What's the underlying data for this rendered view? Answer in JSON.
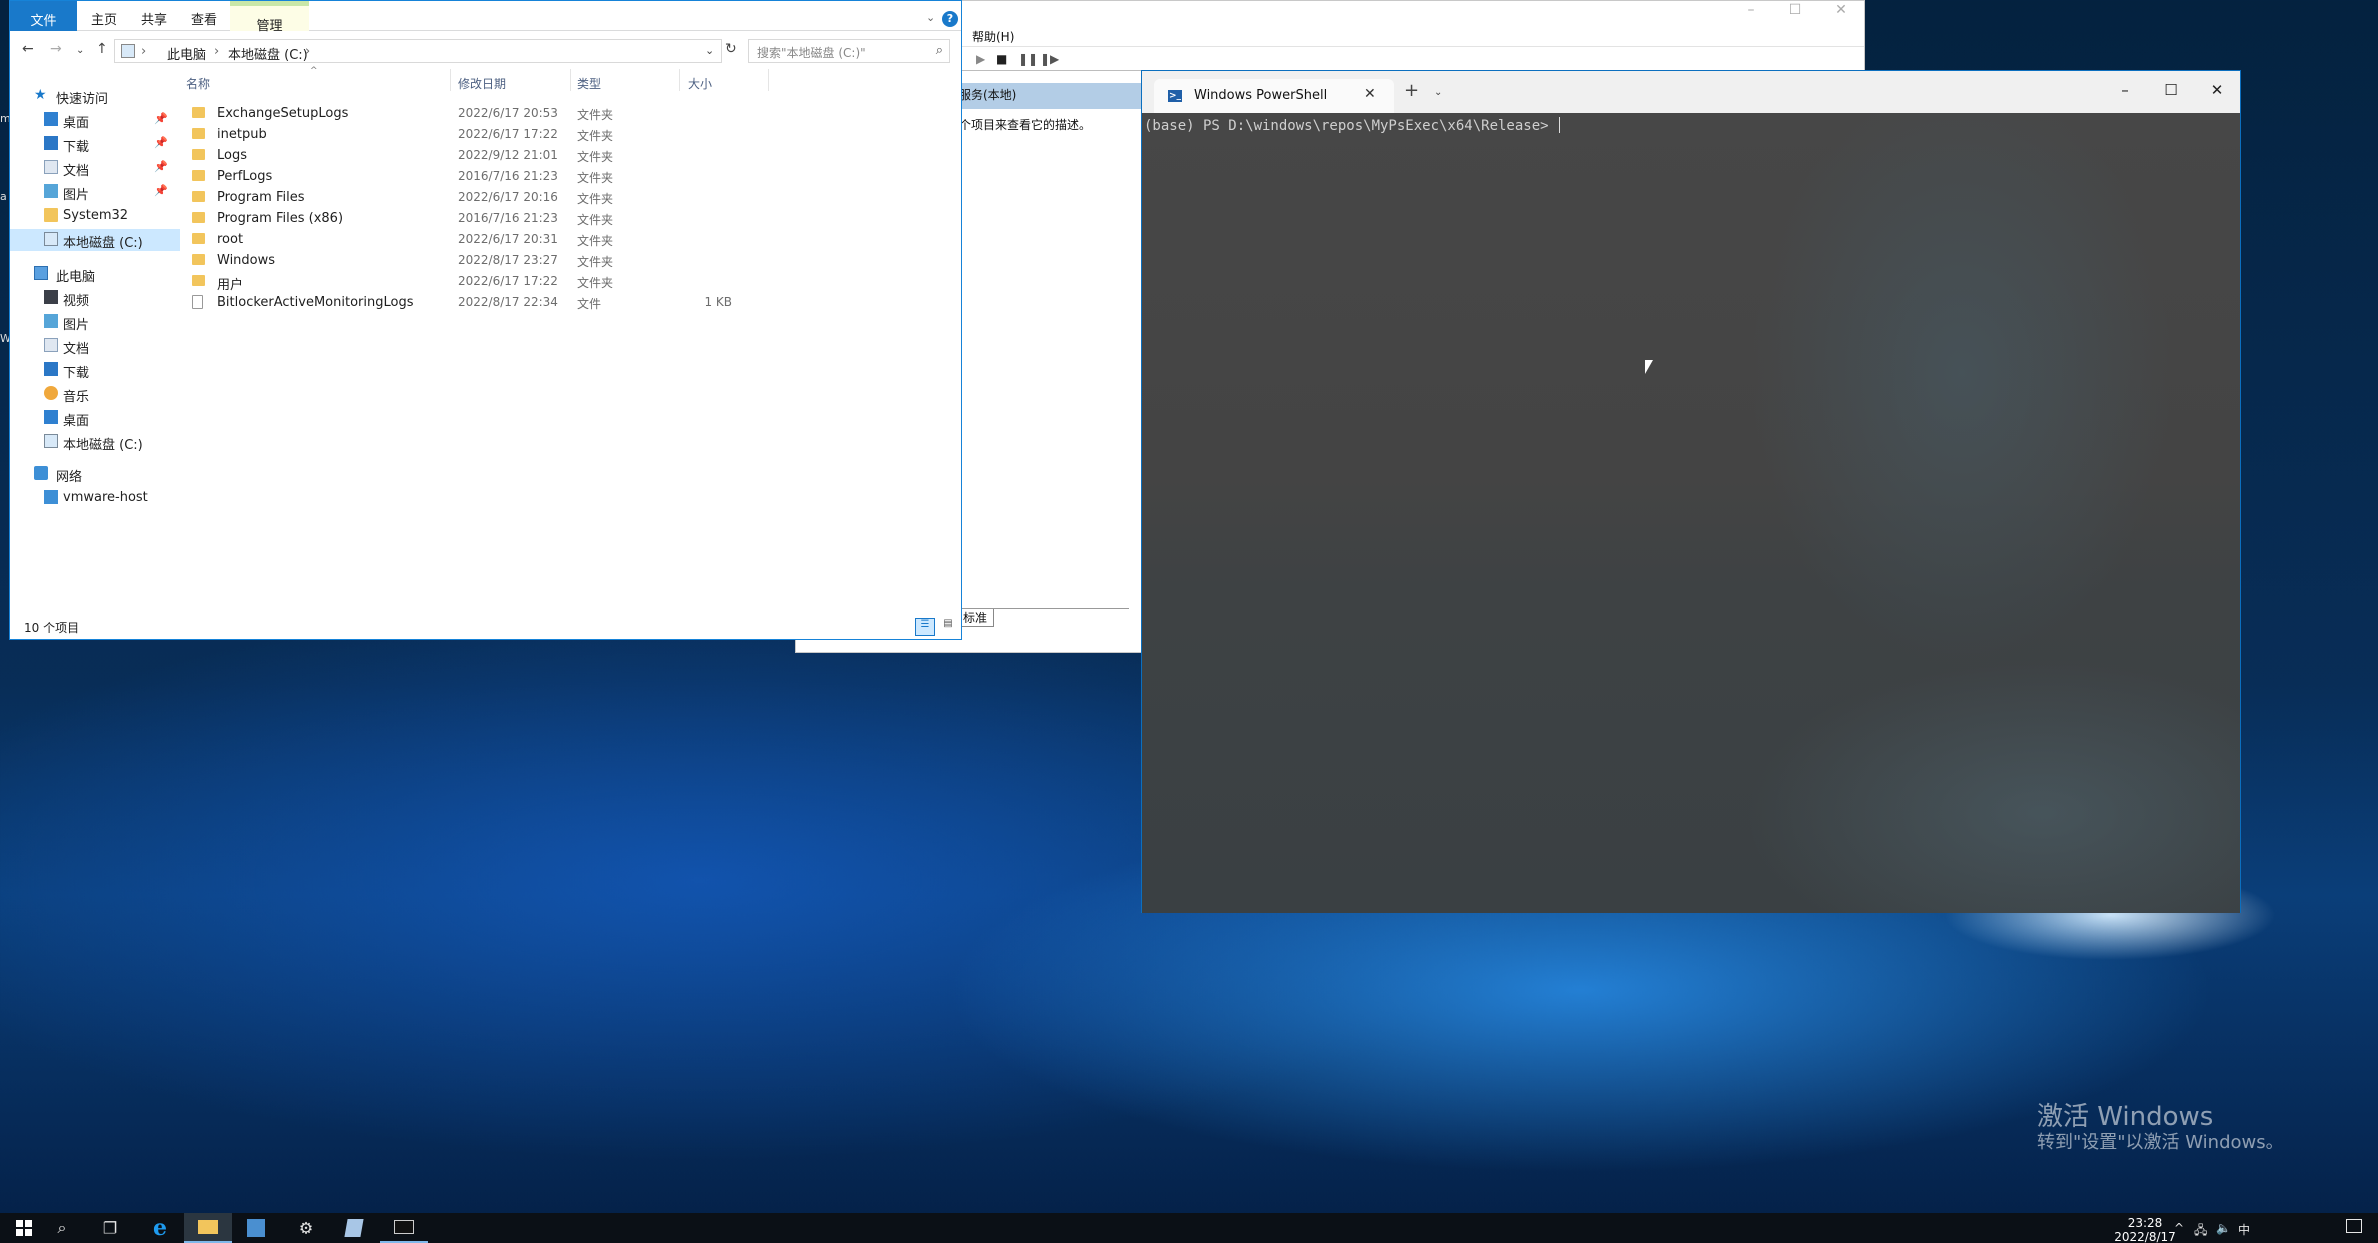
{
  "explorer": {
    "tabs": {
      "file": "文件",
      "home": "主页",
      "share": "共享",
      "view": "查看",
      "manage": "管理"
    },
    "address": {
      "pc": "此电脑",
      "drive": "本地磁盘 (C:)",
      "sep": "›"
    },
    "search_placeholder": "搜索\"本地磁盘 (C:)\"",
    "nav": {
      "quick_access": "快速访问",
      "qa_desktop": "桌面",
      "qa_downloads": "下载",
      "qa_documents": "文档",
      "qa_pictures": "图片",
      "qa_system32": "System32",
      "qa_drive": "本地磁盘 (C:)",
      "this_pc": "此电脑",
      "pc_videos": "视频",
      "pc_pictures": "图片",
      "pc_documents": "文档",
      "pc_downloads": "下载",
      "pc_music": "音乐",
      "pc_desktop": "桌面",
      "pc_drive": "本地磁盘 (C:)",
      "network": "网络",
      "net_host": "vmware-host"
    },
    "columns": {
      "name": "名称",
      "date": "修改日期",
      "type": "类型",
      "size": "大小"
    },
    "rows": [
      {
        "name": "ExchangeSetupLogs",
        "date": "2022/6/17 20:53",
        "type": "文件夹",
        "size": ""
      },
      {
        "name": "inetpub",
        "date": "2022/6/17 17:22",
        "type": "文件夹",
        "size": ""
      },
      {
        "name": "Logs",
        "date": "2022/9/12 21:01",
        "type": "文件夹",
        "size": ""
      },
      {
        "name": "PerfLogs",
        "date": "2016/7/16 21:23",
        "type": "文件夹",
        "size": ""
      },
      {
        "name": "Program Files",
        "date": "2022/6/17 20:16",
        "type": "文件夹",
        "size": ""
      },
      {
        "name": "Program Files (x86)",
        "date": "2016/7/16 21:23",
        "type": "文件夹",
        "size": ""
      },
      {
        "name": "root",
        "date": "2022/6/17 20:31",
        "type": "文件夹",
        "size": ""
      },
      {
        "name": "Windows",
        "date": "2022/8/17 23:27",
        "type": "文件夹",
        "size": ""
      },
      {
        "name": "用户",
        "date": "2022/6/17 17:22",
        "type": "文件夹",
        "size": ""
      },
      {
        "name": "BitlockerActiveMonitoringLogs",
        "date": "2022/8/17 22:34",
        "type": "文件",
        "size": "1 KB"
      }
    ],
    "status": "10 个项目"
  },
  "services": {
    "menu_help": "帮助(H)",
    "scope": "服务(本地)",
    "description": "个项目来查看它的描述。",
    "tab_standard": "标准"
  },
  "terminal": {
    "tab_title": "Windows PowerShell",
    "prompt": "(base) PS D:\\windows\\repos\\MyPsExec\\x64\\Release> "
  },
  "watermark": {
    "title": "激活 Windows",
    "subtitle": "转到\"设置\"以激活 Windows。"
  },
  "taskbar": {
    "time": "23:28",
    "date": "2022/8/17",
    "ime": "中"
  },
  "colors": {
    "accent": "#1979ca",
    "selection": "#cce8ff",
    "terminal_bg": "#454545"
  }
}
